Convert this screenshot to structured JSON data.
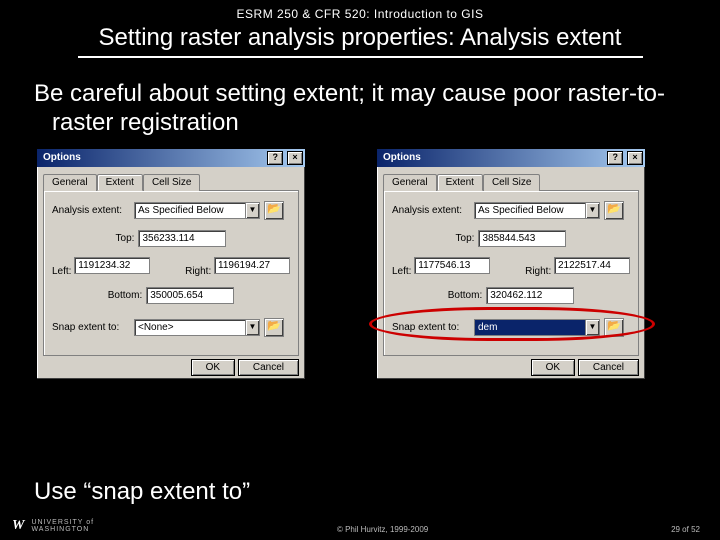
{
  "header": {
    "course": "ESRM 250 & CFR 520: Introduction to GIS",
    "title": "Setting raster analysis properties: Analysis extent"
  },
  "body": {
    "warning": "Be careful about setting extent; it may cause poor raster-to-raster registration",
    "advice": "Use “snap extent to”"
  },
  "dialog": {
    "title": "Options",
    "help": "?",
    "close": "×",
    "tabs": {
      "general": "General",
      "extent": "Extent",
      "cellsize": "Cell Size"
    },
    "labels": {
      "analysis_extent": "Analysis extent:",
      "top": "Top:",
      "left": "Left:",
      "right": "Right:",
      "bottom": "Bottom:",
      "snap": "Snap extent to:"
    },
    "buttons": {
      "ok": "OK",
      "cancel": "Cancel"
    },
    "left": {
      "extent_combo": "As Specified Below",
      "top": "356233.114",
      "left": "1191234.32",
      "right": "1196194.27",
      "bottom": "350005.654",
      "snap_combo": "<None>"
    },
    "right": {
      "extent_combo": "As Specified Below",
      "top": "385844.543",
      "left": "1177546.13",
      "right": "2122517.44",
      "bottom": "320462.112",
      "snap_combo": "dem"
    },
    "folder_icon": "📂"
  },
  "footer": {
    "copyright": "© Phil Hurvitz, 1999-2009",
    "page": "29 of 52",
    "logo_text": "UNIVERSITY of\nWASHINGTON",
    "logo_mark": "W"
  }
}
